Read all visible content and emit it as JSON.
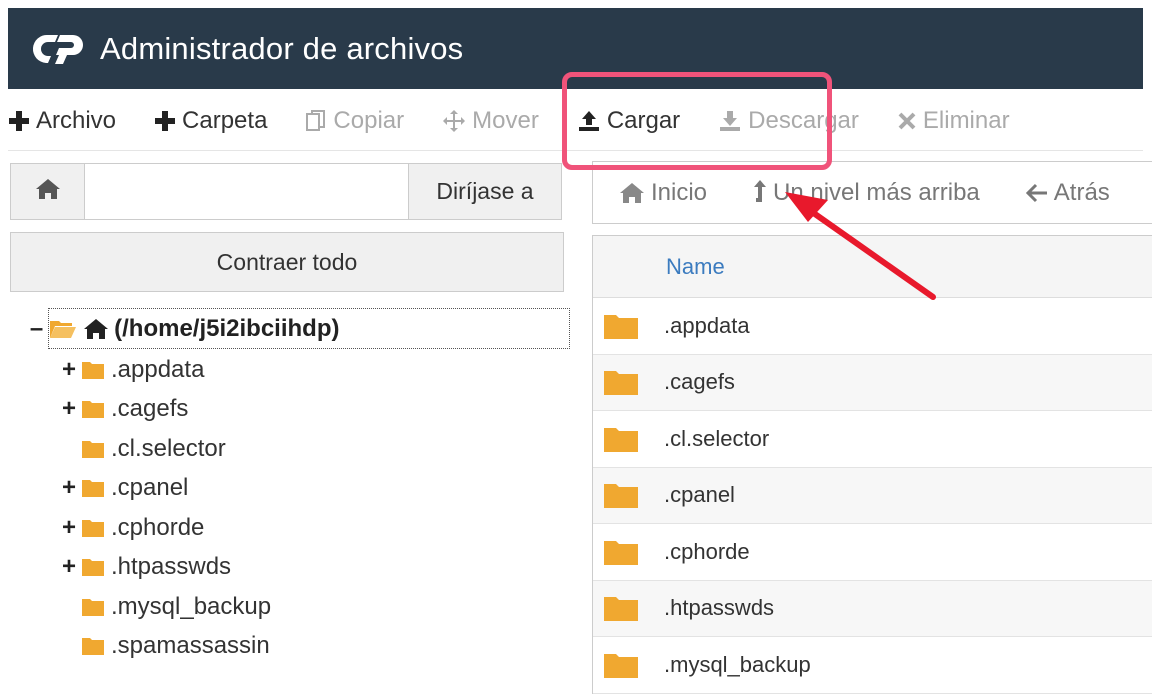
{
  "header": {
    "title": "Administrador de archivos"
  },
  "toolbar": {
    "items": [
      {
        "label": "Archivo",
        "icon": "plus-icon",
        "enabled": true
      },
      {
        "label": "Carpeta",
        "icon": "plus-icon",
        "enabled": true
      },
      {
        "label": "Copiar",
        "icon": "copy-icon",
        "enabled": false
      },
      {
        "label": "Mover",
        "icon": "move-icon",
        "enabled": false
      },
      {
        "label": "Cargar",
        "icon": "upload-icon",
        "enabled": true
      },
      {
        "label": "Descargar",
        "icon": "download-icon",
        "enabled": false
      },
      {
        "label": "Eliminar",
        "icon": "close-icon",
        "enabled": false
      }
    ]
  },
  "navigator": {
    "path_value": "",
    "go_label": "Diríjase a"
  },
  "collapse_label": "Contraer todo",
  "tree": {
    "root": "(/home/j5i2ibciihdp)",
    "items": [
      {
        "name": ".appdata",
        "expandable": true
      },
      {
        "name": ".cagefs",
        "expandable": true
      },
      {
        "name": ".cl.selector",
        "expandable": false
      },
      {
        "name": ".cpanel",
        "expandable": true
      },
      {
        "name": ".cphorde",
        "expandable": true
      },
      {
        "name": ".htpasswds",
        "expandable": true
      },
      {
        "name": ".mysql_backup",
        "expandable": false
      },
      {
        "name": ".spamassassin",
        "expandable": false
      }
    ]
  },
  "right_nav": {
    "home": "Inicio",
    "up": "Un nivel más arriba",
    "back": "Atrás"
  },
  "file_table": {
    "name_header": "Name",
    "rows": [
      ".appdata",
      ".cagefs",
      ".cl.selector",
      ".cpanel",
      ".cphorde",
      ".htpasswds",
      ".mysql_backup"
    ]
  },
  "colors": {
    "header_bg": "#293a4a",
    "highlight": "#f0537a",
    "arrow": "#e8192c",
    "folder": "#f0a830",
    "link": "#3b7bbf"
  }
}
